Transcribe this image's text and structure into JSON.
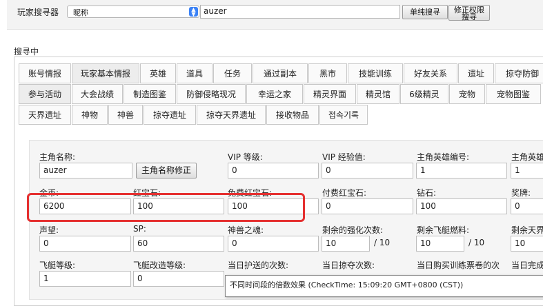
{
  "search": {
    "label": "玩家搜寻器",
    "select_value": "昵称",
    "query": "auzer",
    "btn_simple": "单纯搜寻",
    "btn_perm_line1": "修正权限",
    "btn_perm_line2": "搜寻"
  },
  "section_label": "搜寻中",
  "tabs_row1": [
    "账号情报",
    "玩家基本情报",
    "英雄",
    "道具",
    "任务",
    "通过副本",
    "黑市",
    "技能训练",
    "好友关系",
    "遗址",
    "掠夺防御"
  ],
  "tabs_row2": [
    "参与活动",
    "大会战绩",
    "制造图鉴",
    "防御侵略现况",
    "幸运之家",
    "精灵界面",
    "精灵馆",
    "6级精灵",
    "宠物",
    "宠物图鉴"
  ],
  "tabs_row3": [
    "天界遗址",
    "神物",
    "神兽",
    "掠夺遗址",
    "掠夺天界遗址",
    "接收物品",
    "접속기록"
  ],
  "fields": {
    "hero_name_label": "主角名称:",
    "hero_name_value": "auzer",
    "hero_name_btn": "主角名称修正",
    "vip_level_label": "VIP 等级:",
    "vip_level_value": "0",
    "vip_exp_label": "VIP 经验值:",
    "vip_exp_value": "0",
    "hero_id_label": "主角英雄编号:",
    "hero_id_value": "1",
    "hero_id2_label": "主角英雄",
    "hero_id2_value": "1",
    "gold_label": "金币:",
    "gold_value": "6200",
    "ruby_label": "红宝石:",
    "ruby_value": "100",
    "free_ruby_label": "免费红宝石:",
    "free_ruby_value": "100",
    "paid_ruby_label": "付费红宝石:",
    "paid_ruby_value": "0",
    "diamond_label": "钻石:",
    "diamond_value": "100",
    "medal_label": "奖牌:",
    "medal_value": "0",
    "fame_label": "声望:",
    "fame_value": "0",
    "sp_label": "SP:",
    "sp_value": "60",
    "soul_label": "神兽之魂:",
    "soul_value": "0",
    "enhance_label": "剩余的强化次数:",
    "enhance_value": "10",
    "enhance_max": "/ 10",
    "fuel_label": "剩余飞艇燃料:",
    "fuel_value": "10",
    "fuel_max": "/ 10",
    "sky_label": "剩余天界",
    "sky_value": "10",
    "airship_level_label": "飞艇等级:",
    "airship_level_value": "1",
    "airship_mod_label": "飞艇改造等级:",
    "airship_mod_value": "0",
    "escort_label": "当日护送的次数:",
    "plunder_label": "当日掠夺次数:",
    "ticket_label": "当日购买训练票卷的次",
    "complete_label": "当日完成"
  },
  "tooltip": "不同时间段的倍数效果 (CheckTime: 15:09:20 GMT+0800 (CST))",
  "colors": {
    "highlight": "#e53030",
    "select_arrow": "#3b82f6"
  }
}
